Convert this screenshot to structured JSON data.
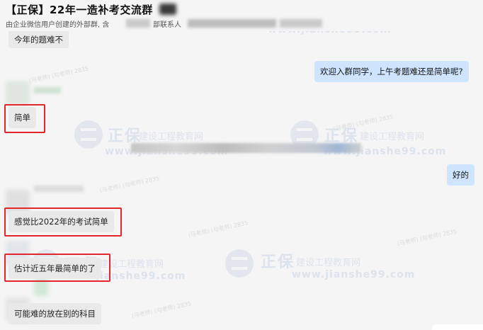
{
  "header": {
    "title": "【正保】22年一造补考交流群",
    "subtitle_left": "由企业微信用户创建的外部群, 含",
    "subtitle_right": "部联系人"
  },
  "watermark": {
    "brand": "正保",
    "slogan": "建设工程教育网",
    "url": "www.jianshe99.com",
    "diagonal": "(马老师) (勾老师) 2835"
  },
  "messages": [
    {
      "text": "今年的题难不",
      "side": "in"
    },
    {
      "text": "欢迎入群同学，上午考题难还是简单呢?",
      "side": "out"
    },
    {
      "text": "简单",
      "side": "in",
      "highlighted": true
    },
    {
      "text": "好的",
      "side": "out"
    },
    {
      "text": "感觉比2022年的考试简单",
      "side": "in",
      "highlighted": true
    },
    {
      "text": "估计近五年最简单的了",
      "side": "in",
      "highlighted": true
    },
    {
      "text": "可能难的放在别的科目",
      "side": "in"
    }
  ],
  "colors": {
    "incoming_bubble": "#e9e9e9",
    "outgoing_bubble": "#cfe5ff",
    "highlight_box": "#e3262c",
    "background": "#f5f5f5"
  }
}
